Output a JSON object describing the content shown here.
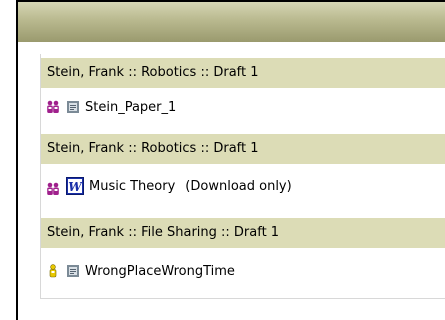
{
  "groups": [
    {
      "header": "Stein, Frank :: Robotics :: Draft 1",
      "item": {
        "title": "Stein_Paper_1",
        "note": "",
        "owner_icon": "group-users-icon",
        "doc_icon": "generic-document-icon"
      }
    },
    {
      "header": "Stein, Frank :: Robotics :: Draft 1",
      "item": {
        "title": "Music Theory",
        "note": "(Download only)",
        "owner_icon": "group-users-icon",
        "doc_icon": "word-document-icon"
      }
    },
    {
      "header": "Stein, Frank :: File Sharing :: Draft 1",
      "item": {
        "title": "WrongPlaceWrongTime",
        "note": "",
        "owner_icon": "single-user-icon",
        "doc_icon": "generic-document-icon"
      }
    }
  ],
  "colors": {
    "header_band": "#dcdcb6",
    "top_bar": "#b9b98f",
    "group_icon": "#a0208c",
    "single_user_icon": "#e8c800",
    "word_icon": "#1a2fa8"
  }
}
